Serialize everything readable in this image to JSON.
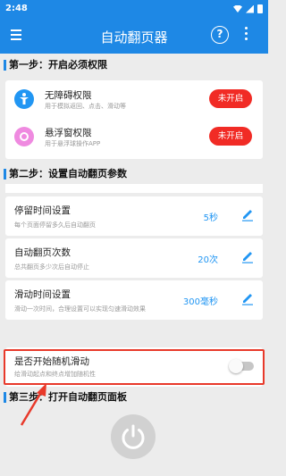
{
  "status_bar": {
    "time": "2:48"
  },
  "app_bar": {
    "title": "自动翻页器",
    "help_label": "?"
  },
  "section1": {
    "title": "第一步：开启必须权限"
  },
  "permissions": [
    {
      "name": "无障碍权限",
      "desc": "用于模拟返回、点击、滑动等",
      "button": "未开启",
      "icon": "accessibility-icon"
    },
    {
      "name": "悬浮窗权限",
      "desc": "用于悬浮球操作APP",
      "button": "未开启",
      "icon": "floating-window-icon"
    }
  ],
  "section2": {
    "title": "第二步：设置自动翻页参数"
  },
  "settings": [
    {
      "name": "停留时间设置",
      "desc": "每个页面停留多久后自动翻页",
      "value": "5秒"
    },
    {
      "name": "自动翻页次数",
      "desc": "总共翻页多少次后自动停止",
      "value": "20次"
    },
    {
      "name": "滑动时间设置",
      "desc": "滑动一次时间，合理设置可以实现匀速滑动效果",
      "value": "300毫秒"
    }
  ],
  "random_swipe": {
    "name": "是否开始随机滑动",
    "desc": "给滑动起点和终点增加随机性",
    "enabled": false
  },
  "section3": {
    "title": "第三步：打开自动翻页面板"
  },
  "colors": {
    "primary": "#1e88e5",
    "danger": "#f12b25",
    "highlight": "#e8392a"
  }
}
